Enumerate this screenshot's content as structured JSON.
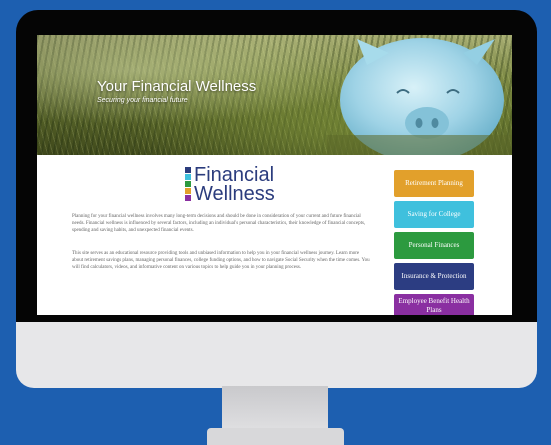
{
  "hero": {
    "title": "Your Financial Wellness",
    "subtitle": "Securing your financial future"
  },
  "logo": {
    "line1": "Financial",
    "line2": "Wellness",
    "bar_colors": [
      "#2b3c7d",
      "#3fc0dd",
      "#2c9a3f",
      "#e2a02b",
      "#8a2fa1"
    ]
  },
  "body": {
    "paragraph1": "Planning for your financial wellness involves many long-term decisions and should be done in consideration of your current and future financial needs. Financial wellness is influenced by several factors, including an individual's personal characteristics, their knowledge of financial concepts, spending and saving habits, and unexpected financial events.",
    "paragraph2": "This site serves as an educational resource providing tools and unbiased information to help you in your financial wellness journey. Learn more about retirement savings plans, managing personal finances, college funding options, and how to navigate Social Security when the time comes. You will find calculators, videos, and informative content on various topics to help guide you in your planning process."
  },
  "nav": [
    {
      "label": "Retirement Planning",
      "color": "#e2a02b"
    },
    {
      "label": "Saving for College",
      "color": "#3fc0dd"
    },
    {
      "label": "Personal Finances",
      "color": "#2c9a3f"
    },
    {
      "label": "Insurance & Protection",
      "color": "#2c3d82"
    },
    {
      "label": "Employee Benefit Health Plans",
      "color": "#8a2fa1"
    }
  ],
  "colors": {
    "background": "#1d5fb0",
    "bezel": "#050505",
    "chin": "#e7e7e9"
  }
}
